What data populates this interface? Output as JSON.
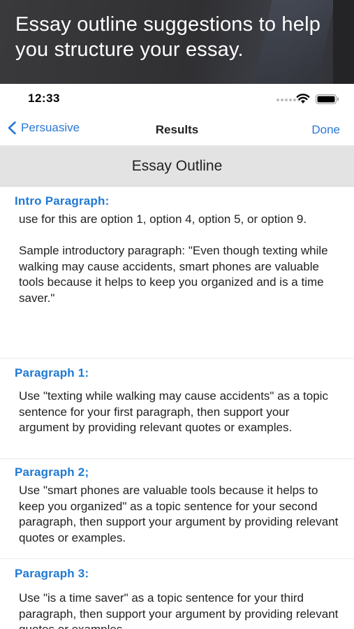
{
  "promo": {
    "title": "Essay outline suggestions to help you structure your essay."
  },
  "status_bar": {
    "time": "12:33",
    "icons": [
      "signal-dots-icon",
      "wifi-icon",
      "battery-icon"
    ]
  },
  "nav": {
    "back_label": "Persuasive",
    "title": "Results",
    "done_label": "Done"
  },
  "section_header": "Essay Outline",
  "paragraphs": [
    {
      "title": "Intro Paragraph:",
      "body": "use for this are option 1, option 4, option 5, or option 9.\n\n Sample introductory paragraph: \"Even though texting while walking may cause accidents, smart phones are valuable tools because it helps to keep you organized and is a time saver.\""
    },
    {
      "title": "Paragraph 1:",
      "body": "Use \"texting while walking may cause accidents\" as a topic sentence for your first paragraph, then support your argument by providing relevant quotes or examples."
    },
    {
      "title": "Paragraph 2;",
      "body": "Use \"smart phones are valuable tools because it helps to keep you organized\" as a topic sentence for your second paragraph, then support your argument by providing relevant quotes or examples."
    },
    {
      "title": "Paragraph 3:",
      "body": "Use \"is a time saver\" as a topic sentence for your third paragraph, then support your argument by providing relevant quotes or examples."
    }
  ],
  "colors": {
    "accent": "#2a78d6",
    "heading_blue": "#1f79d4",
    "header_gray": "#e3e3e3",
    "promo_bg": "#333336"
  }
}
